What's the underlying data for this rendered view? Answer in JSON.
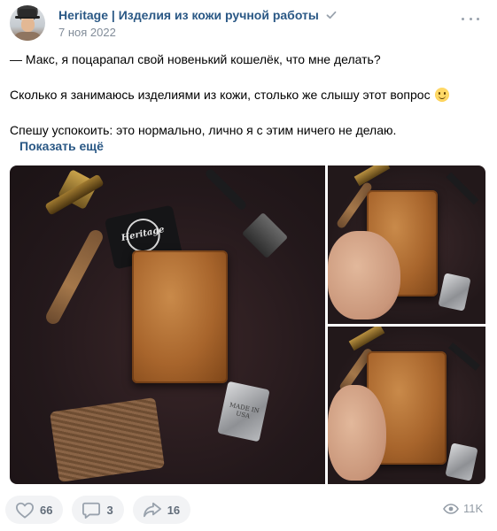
{
  "header": {
    "author": "Heritage",
    "separator": "|",
    "community": "Изделия из кожи ручной работы",
    "date": "7 ноя 2022"
  },
  "post": {
    "line1": "— Макс, я поцарапал свой новенький кошелёк, что мне делать?",
    "line2": "Сколько я занимаюсь изделиями из кожи, столько же слышу этот вопрос",
    "line3": "Спешу успокоить: это нормально, лично я с этим ничего не делаю.",
    "show_more": "Показать ещё"
  },
  "photos": {
    "card_text": "Heritage",
    "lighter_text": "MADE IN\nUSA"
  },
  "footer": {
    "likes": "66",
    "comments": "3",
    "shares": "16",
    "views": "11K"
  },
  "colors": {
    "link": "#2a5885",
    "muted": "#818c99",
    "button_bg": "#f2f3f5",
    "icon": "#99a2ad"
  },
  "icons": [
    "verified-icon",
    "menu-icon",
    "heart-icon",
    "comment-icon",
    "share-icon",
    "eye-icon"
  ]
}
